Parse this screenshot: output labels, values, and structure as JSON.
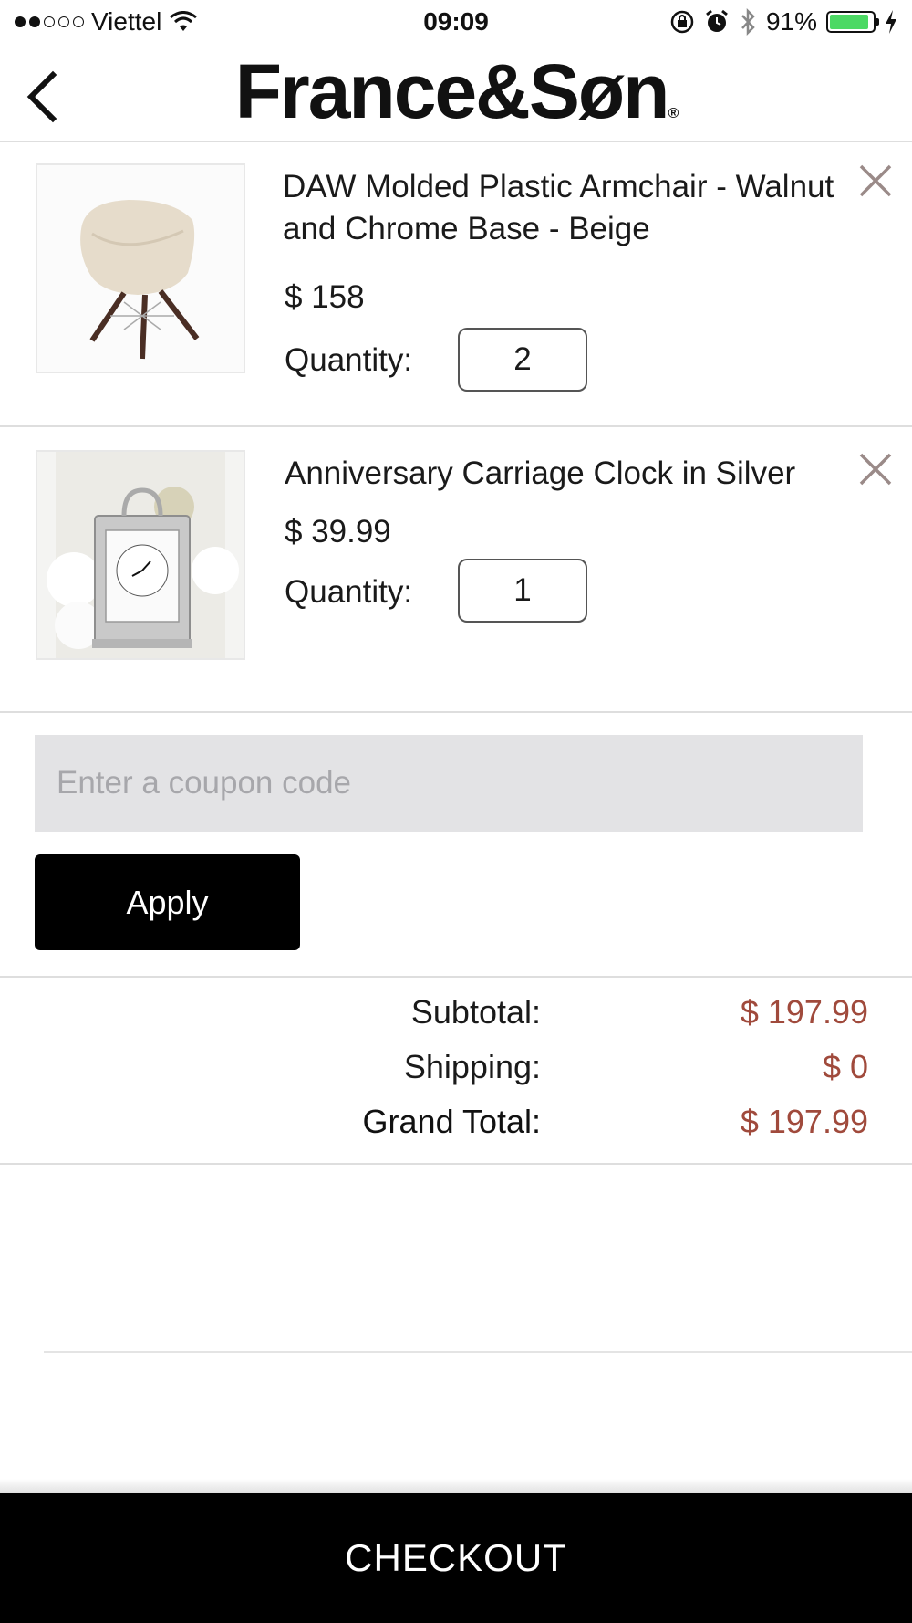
{
  "status_bar": {
    "carrier": "Viettel",
    "time": "09:09",
    "battery": "91%",
    "battery_level": 0.91,
    "signal_bars": 2
  },
  "header": {
    "logo_text": "France&Søn",
    "logo_mark": "®"
  },
  "cart": {
    "items": [
      {
        "name": "DAW Molded Plastic Armchair - Walnut and Chrome Base - Beige",
        "price": "$ 158",
        "quantity_label": "Quantity:",
        "quantity": "2",
        "image_icon": "armchair-image"
      },
      {
        "name": "Anniversary Carriage Clock in Silver",
        "price": "$ 39.99",
        "quantity_label": "Quantity:",
        "quantity": "1",
        "image_icon": "carriage-clock-image"
      }
    ]
  },
  "coupon": {
    "placeholder": "Enter a coupon code",
    "apply_label": "Apply"
  },
  "totals": {
    "subtotal_label": "Subtotal:",
    "subtotal_value": "$ 197.99",
    "shipping_label": "Shipping:",
    "shipping_value": "$ 0",
    "grand_total_label": "Grand Total:",
    "grand_total_value": "$ 197.99"
  },
  "checkout_label": "CHECKOUT",
  "colors": {
    "price_accent": "#a04a3c",
    "button_bg": "#000000",
    "coupon_bg": "#e3e3e5",
    "battery_fill": "#4cd964"
  }
}
